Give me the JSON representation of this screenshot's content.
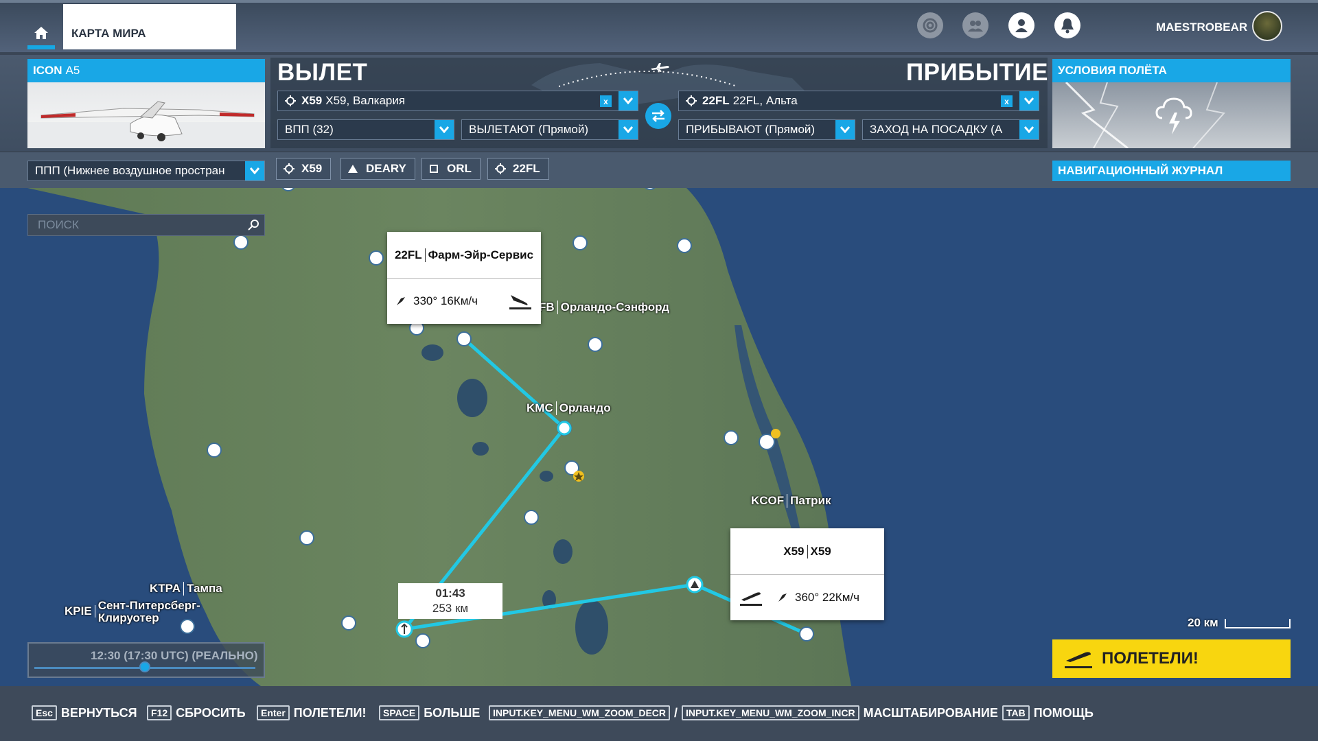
{
  "topbar": {
    "tab_label": "КАРТА МИРА",
    "username": "MAESTROBEAR"
  },
  "aircraft": {
    "title_model": "ICON",
    "title_variant": "A5"
  },
  "route": {
    "departure_title": "ВЫЛЕТ",
    "arrival_title": "ПРИБЫТИЕ",
    "departure_code": "X59",
    "departure_name": "X59, Валкария",
    "arrival_code": "22FL",
    "arrival_name": "22FL, Альта",
    "clear_label": "x",
    "runway": "ВПП (32)",
    "departure_proc": "ВЫЛЕТАЮТ (Прямой)",
    "arrival_proc": "ПРИБЫВАЮТ (Прямой)",
    "approach": "ЗАХОД НА ПОСАДКУ (А"
  },
  "conditions": {
    "title": "УСЛОВИЯ ПОЛЁТА"
  },
  "filters": {
    "flight_rule": "ППП (Нижнее воздушное простран",
    "waypoints": [
      "X59",
      "DEARY",
      "ORL",
      "22FL"
    ],
    "nav_log": "НАВИГАЦИОННЫЙ ЖУРНАЛ"
  },
  "map": {
    "search_placeholder": "ПОИСК",
    "labels": {
      "sanford_code": "FB",
      "sanford_name": "Орландо-Сэнфорд",
      "orlando_code": "KMC",
      "orlando_name": "Орландо",
      "patrick_code": "KCOF",
      "patrick_name": "Патрик",
      "tampa_code": "KTPA",
      "tampa_name": "Тампа",
      "pie_code": "KPIE",
      "pie_name_1": "Сент-Питерсберг-",
      "pie_name_2": "Клируотер"
    },
    "arrival_popup": {
      "code": "22FL",
      "name": "Фарм-Эйр-Сервис",
      "wind": "330° 16Км/ч"
    },
    "departure_popup": {
      "code": "X59",
      "name": "X59",
      "wind": "360° 22Км/ч"
    },
    "leg_time": "01:43",
    "leg_distance": "253 км",
    "time_of_day": "12:30 (17:30 UTC) (РЕАЛЬНО)",
    "time_slider_fraction": 0.5,
    "scale_label": "20 км",
    "fly_button": "ПОЛЕТЕЛИ!"
  },
  "footer": {
    "back_key": "Esc",
    "back_label": "ВЕРНУТЬСЯ",
    "reset_key": "F12",
    "reset_label": "СБРОСИТЬ",
    "fly_key": "Enter",
    "fly_label": "ПОЛЕТЕЛИ!",
    "more_key": "SPACE",
    "more_label": "БОЛЬШЕ",
    "zoom_dec_key": "INPUT.KEY_MENU_WM_ZOOM_DECR",
    "zoom_sep": "/",
    "zoom_inc_key": "INPUT.KEY_MENU_WM_ZOOM_INCR",
    "zoom_label": "МАСШТАБИРОВАНИЕ",
    "help_key": "TAB",
    "help_label": "ПОМОЩЬ"
  },
  "colors": {
    "accent": "#19a7e6",
    "route_line": "#22c8e4",
    "fly_button": "#f8d60f"
  }
}
